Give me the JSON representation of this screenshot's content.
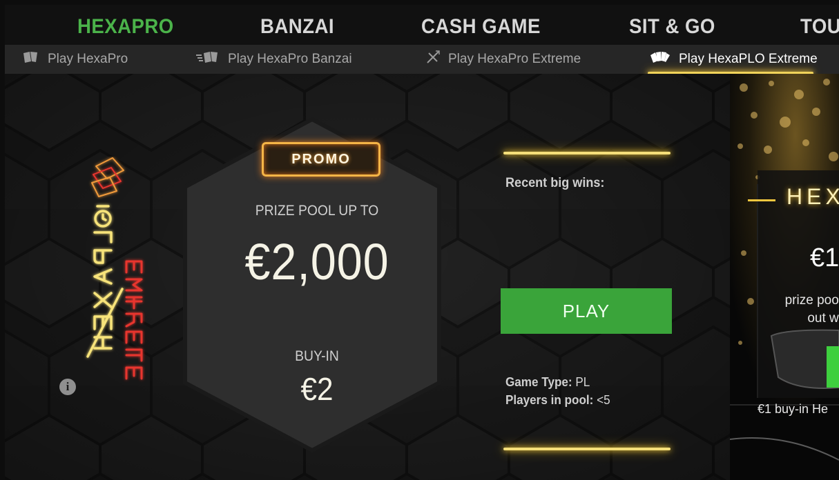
{
  "topnav": {
    "tabs": [
      {
        "label": "HEXAPRO",
        "active": true
      },
      {
        "label": "BANZAI",
        "active": false
      },
      {
        "label": "CASH GAME",
        "active": false
      },
      {
        "label": "SIT & GO",
        "active": false
      },
      {
        "label": "TOU",
        "active": false
      }
    ]
  },
  "subnav": {
    "items": [
      {
        "label": "Play HexaPro",
        "icon": "cards-icon",
        "active": false
      },
      {
        "label": "Play HexaPro Banzai",
        "icon": "speed-cards-icon",
        "active": false
      },
      {
        "label": "Play HexaPro Extreme",
        "icon": "crossed-swords-icon",
        "active": false
      },
      {
        "label": "Play HexaPLO Extreme",
        "icon": "fan-cards-icon",
        "active": true
      }
    ]
  },
  "game": {
    "promo_badge": "PROMO",
    "prize_label": "PRIZE POOL UP TO",
    "prize_value": "€2,000",
    "buyin_label": "BUY-IN",
    "buyin_value": "€2",
    "recent_label": "Recent big wins:",
    "play_label": "PLAY",
    "game_type_label": "Game Type:",
    "game_type_value": "PL",
    "players_label": "Players in pool:",
    "players_value": "<5",
    "info_glyph": "i"
  },
  "logo": {
    "text": "HEXAPLŌ",
    "subtext": "EXTREME"
  },
  "card": {
    "title": "HEX",
    "amount": "€1",
    "desc_line1": "prize pool",
    "desc_line2": "out wi",
    "footer": "€1 buy-in He"
  },
  "colors": {
    "accent_green": "#4bb34a",
    "play_green": "#3aa43a",
    "gold_glow": "#f5df7a",
    "promo_orange": "#f5b547",
    "logo_yellow": "#f7e37a",
    "logo_red": "#e8352e"
  }
}
